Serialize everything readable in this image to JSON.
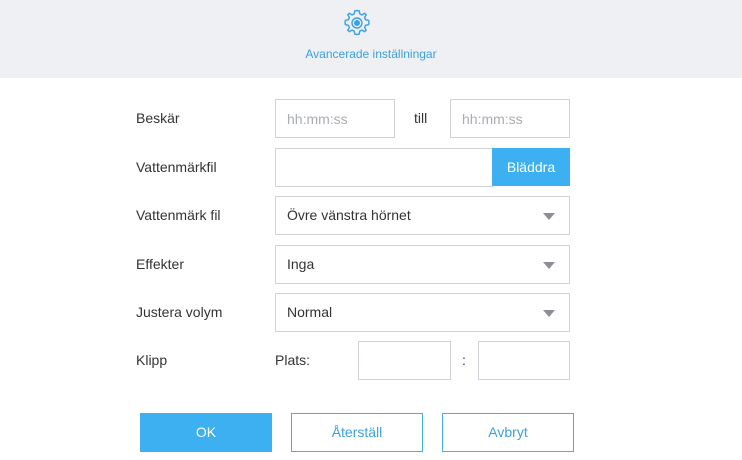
{
  "header": {
    "icon": "gear-icon",
    "title": "Avancerade inställningar"
  },
  "trim": {
    "label": "Beskär",
    "start_placeholder": "hh:mm:ss",
    "separator": "till",
    "end_placeholder": "hh:mm:ss"
  },
  "watermark_file": {
    "label": "Vattenmärkfil",
    "value": "",
    "browse_label": "Bläddra"
  },
  "watermark_position": {
    "label": "Vattenmärk fil",
    "selected": "Övre vänstra hörnet"
  },
  "effects": {
    "label": "Effekter",
    "selected": "Inga"
  },
  "volume": {
    "label": "Justera volym",
    "selected": "Normal"
  },
  "crop": {
    "label": "Klipp",
    "position_label": "Plats:",
    "separator": ":",
    "x_value": "",
    "y_value": ""
  },
  "buttons": {
    "ok": "OK",
    "reset": "Återställ",
    "cancel": "Avbryt"
  },
  "colors": {
    "accent": "#3cb0f0",
    "header_bg": "#eef0f4"
  }
}
